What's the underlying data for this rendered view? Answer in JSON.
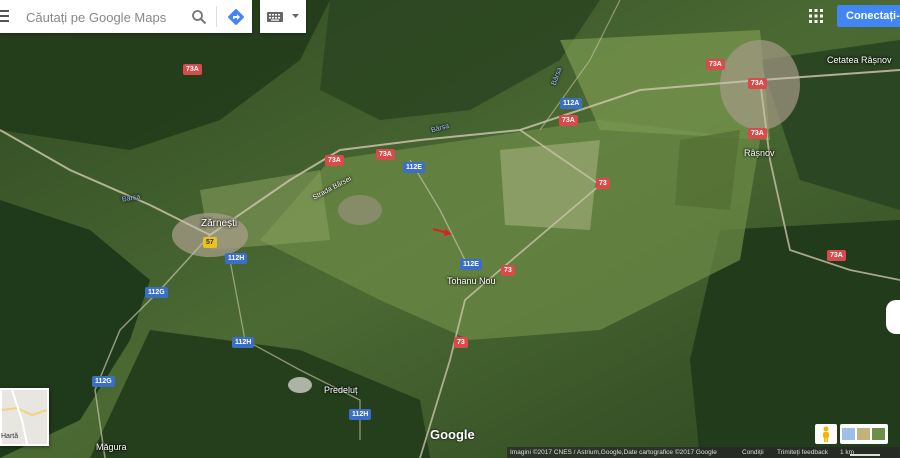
{
  "search": {
    "placeholder": "Căutați pe Google Maps"
  },
  "header": {
    "signin_label": "Conectați-vă"
  },
  "places": {
    "zarnesti": "Zărnești",
    "tohanu_nou": "Tohanu Nou",
    "predelut": "Predeluț",
    "magura": "Măgura",
    "rasnov": "Râșnov",
    "cetatea_rasnov": "Cetatea Râșnov",
    "strada_barsei": "Strada Bârsei",
    "barsa_1": "Bârsa",
    "barsa_2": "Bârsa",
    "barsa_3": "Bârsa"
  },
  "roads": {
    "r73a_1": "73A",
    "r73a_2": "73A",
    "r73a_3": "73A",
    "r73a_4": "73A",
    "r73a_5": "73A",
    "r73a_6": "73A",
    "r73a_7": "73A",
    "r73a_8": "73A",
    "r73_1": "73",
    "r73_2": "73",
    "r73_3": "73",
    "r112a": "112A",
    "r112e_1": "112E",
    "r112e_2": "112E",
    "r112h_1": "112H",
    "r112h_2": "112H",
    "r112h_3": "112H",
    "r112g_1": "112G",
    "r112g_2": "112G",
    "r57": "57"
  },
  "layer_switch": {
    "label": "Hartă"
  },
  "logo": "Google",
  "footer": {
    "attribution": "Imagini ©2017 CNES / Astrium,Google,Date cartografice ©2017 Google",
    "terms": "Condiții",
    "feedback": "Trimiteți feedback",
    "scale": "1 km"
  },
  "colors": {
    "accent": "#4285f4",
    "road_national": "#d94b4b",
    "road_county": "#3a6fc4"
  },
  "icons": {
    "menu": "hamburger-menu-icon",
    "search": "search-icon",
    "directions": "directions-icon",
    "keyboard": "keyboard-icon",
    "apps": "apps-grid-icon",
    "pegman": "pegman-icon"
  }
}
